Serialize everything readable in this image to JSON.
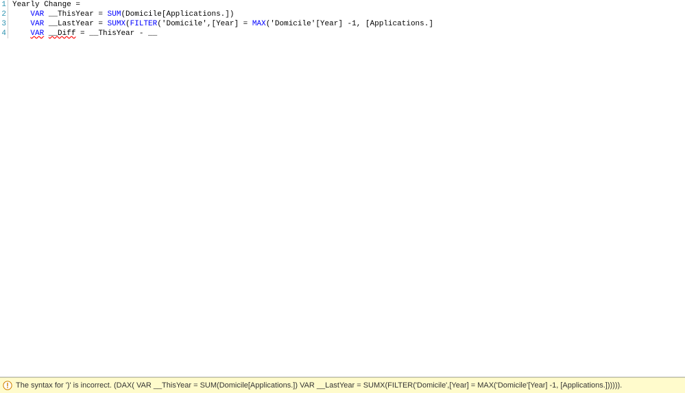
{
  "editor": {
    "lines": [
      {
        "num": "1"
      },
      {
        "num": "2"
      },
      {
        "num": "3"
      },
      {
        "num": "4"
      }
    ],
    "line1": {
      "t1": "Yearly Change ="
    },
    "line2": {
      "indent": "    ",
      "var": "VAR",
      "name": " __ThisYear = ",
      "func": "SUM",
      "args": "(Domicile[Applications.])"
    },
    "line3": {
      "indent": "    ",
      "var": "VAR",
      "name": " __LastYear = ",
      "func1": "SUMX",
      "p1": "(",
      "func2": "FILTER",
      "p2": "('Domicile',[Year] = ",
      "func3": "MAX",
      "p3": "('Domicile'[Year] -1, [Applications.]"
    },
    "line4": {
      "indent": "    ",
      "var": "VAR",
      "sp": " ",
      "name_wavy": "__Diff",
      "rest": " = __ThisYear - __"
    }
  },
  "status": {
    "message": "The syntax for ')' is incorrect. (DAX( VAR __ThisYear = SUM(Domicile[Applications.]) VAR __LastYear = SUMX(FILTER('Domicile',[Year] = MAX('Domicile'[Year] -1, [Applications.])))))."
  }
}
